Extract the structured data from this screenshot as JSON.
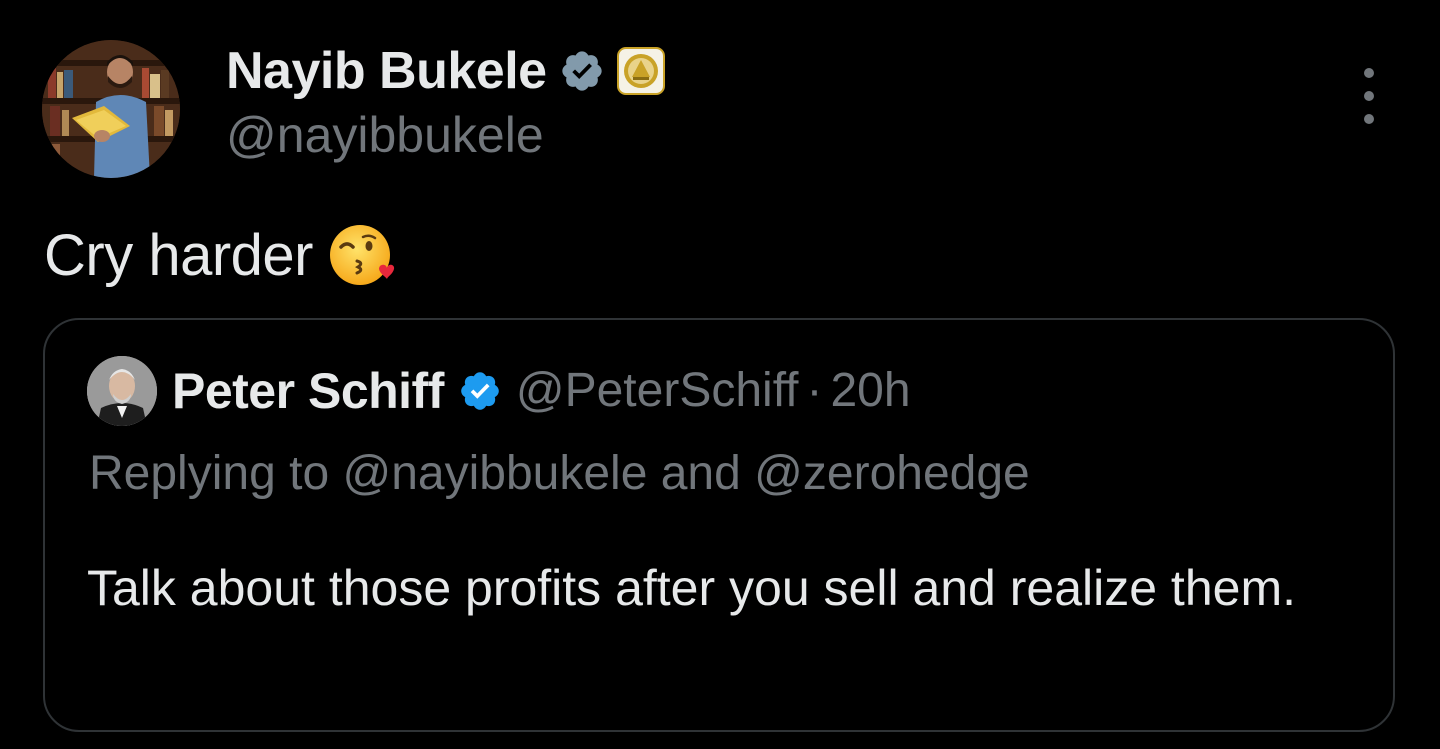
{
  "tweet": {
    "author": {
      "display_name": "Nayib Bukele",
      "handle": "@nayibbukele",
      "verified_badge": "gray-verified-check-icon",
      "affiliation_badge": "government-seal-icon"
    },
    "text": "Cry harder",
    "emoji": "😘",
    "more_icon": "more-vertical-icon",
    "quoted_tweet": {
      "author": {
        "display_name": "Peter Schiff",
        "handle": "@PeterSchiff",
        "verified_badge": "blue-verified-check-icon"
      },
      "separator": "·",
      "time": "20h",
      "replying_to": "Replying to @nayibbukele and @zerohedge",
      "text": "Talk about those profits after you sell and realize them."
    }
  },
  "colors": {
    "background": "#000000",
    "primary_text": "#e7e9ea",
    "secondary_text": "#71767b",
    "border": "#2f3336",
    "verified_blue": "#1d9bf0",
    "verified_gray": "#829aab",
    "seal_gold": "#c9a227"
  }
}
